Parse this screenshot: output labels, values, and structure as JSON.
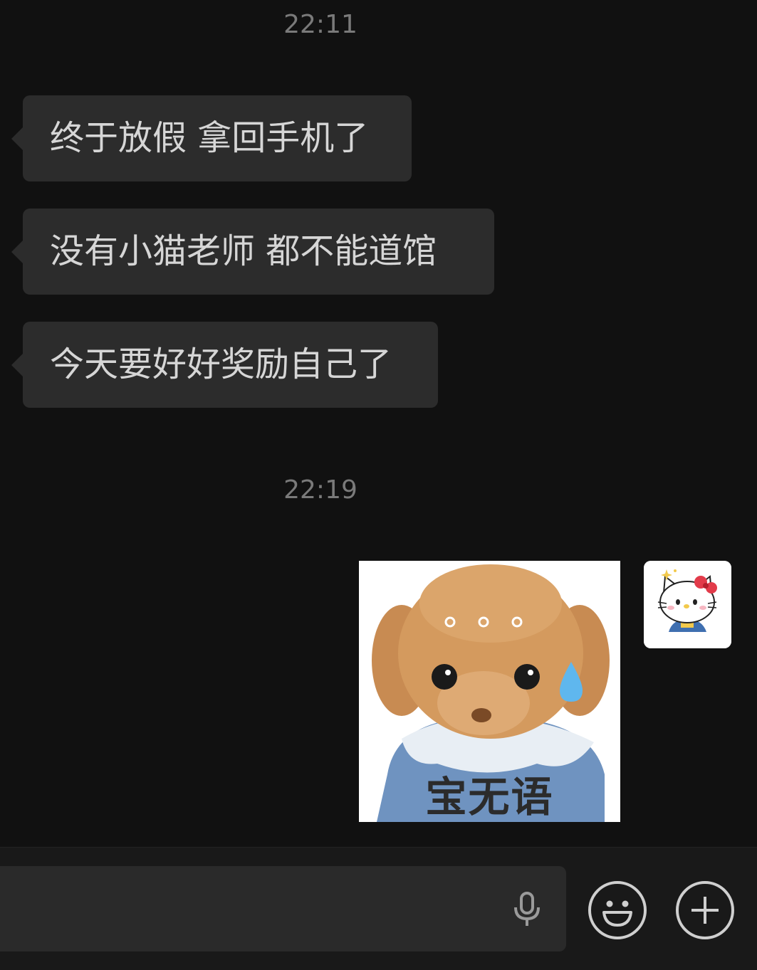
{
  "messages": {
    "time_1": "22:11",
    "bubble_1": "终于放假 拿回手机了",
    "bubble_2": "没有小猫老师 都不能道馆",
    "bubble_3": "今天要好好奖励自己了",
    "time_2": "22:19",
    "sticker_caption": "宝无语"
  },
  "input_bar": {
    "mic_icon": "microphone-icon",
    "emoji_icon": "smiley-face-icon",
    "plus_icon": "plus-icon"
  },
  "colors": {
    "background": "#111111",
    "bubble": "#2c2c2c",
    "bubble_text": "#d6d6d6",
    "timestamp": "#7a7a7a",
    "icon": "#cfcfcf"
  }
}
